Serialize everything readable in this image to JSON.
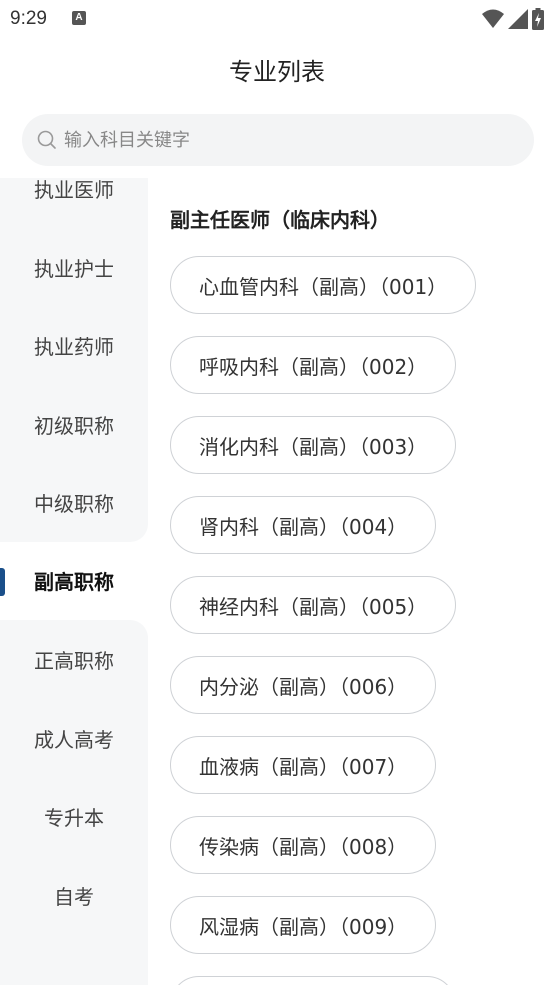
{
  "status_bar": {
    "time": "9:29",
    "notification_icon": "A"
  },
  "header": {
    "title": "专业列表"
  },
  "search": {
    "placeholder": "输入科目关键字",
    "value": ""
  },
  "sidebar": {
    "items": [
      {
        "label": "执业医师",
        "active": false
      },
      {
        "label": "执业护士",
        "active": false
      },
      {
        "label": "执业药师",
        "active": false
      },
      {
        "label": "初级职称",
        "active": false
      },
      {
        "label": "中级职称",
        "active": false
      },
      {
        "label": "副高职称",
        "active": true
      },
      {
        "label": "正高职称",
        "active": false
      },
      {
        "label": "成人高考",
        "active": false
      },
      {
        "label": "专升本",
        "active": false
      },
      {
        "label": "自考",
        "active": false
      }
    ],
    "accent_color": "#1a4f8a"
  },
  "content": {
    "section_title": "副主任医师（临床内科）",
    "chips": [
      "心血管内科（副高）（001）",
      "呼吸内科（副高）（002）",
      "消化内科（副高）（003）",
      "肾内科（副高）（004）",
      "神经内科（副高）（005）",
      "内分泌（副高）（006）",
      "血液病（副高）（007）",
      "传染病（副高）（008）",
      "风湿病（副高）（009）"
    ]
  }
}
